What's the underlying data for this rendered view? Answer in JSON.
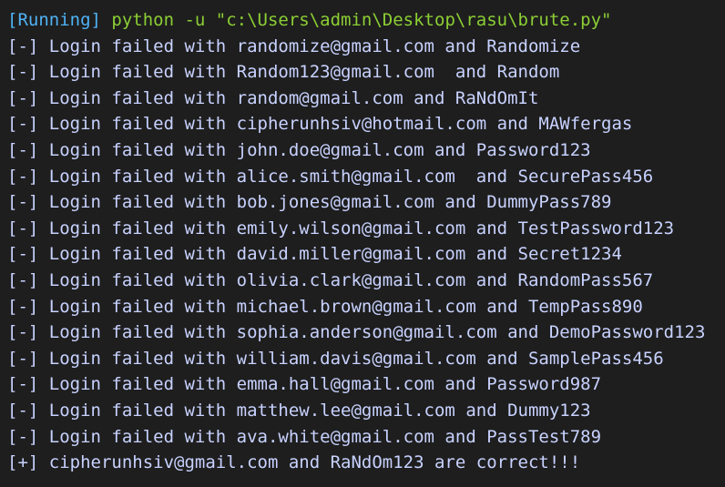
{
  "terminal": {
    "status": "[Running]",
    "command": " python -u \"c:\\Users\\admin\\Desktop\\rasu\\brute.py\"",
    "lines": [
      "[-] Login failed with randomize@gmail.com and Randomize",
      "[-] Login failed with Random123@gmail.com  and Random",
      "[-] Login failed with random@gmail.com and RaNdOmIt",
      "[-] Login failed with cipherunhsiv@hotmail.com and MAWfergas",
      "[-] Login failed with john.doe@gmail.com and Password123",
      "[-] Login failed with alice.smith@gmail.com  and SecurePass456",
      "[-] Login failed with bob.jones@gmail.com and DummyPass789",
      "[-] Login failed with emily.wilson@gmail.com and TestPassword123",
      "[-] Login failed with david.miller@gmail.com and Secret1234",
      "[-] Login failed with olivia.clark@gmail.com and RandomPass567",
      "[-] Login failed with michael.brown@gmail.com and TempPass890",
      "[-] Login failed with sophia.anderson@gmail.com and DemoPassword123",
      "[-] Login failed with william.davis@gmail.com and SamplePass456",
      "[-] Login failed with emma.hall@gmail.com and Password987",
      "[-] Login failed with matthew.lee@gmail.com and Dummy123",
      "[-] Login failed with ava.white@gmail.com and PassTest789",
      "[+] cipherunhsiv@gmail.com and RaNdOm123 are correct!!!"
    ],
    "colors": {
      "background": "#1e1e1e",
      "status": "#4fb3f6",
      "command": "#8ccf34",
      "output": "#c8d2ff"
    }
  }
}
